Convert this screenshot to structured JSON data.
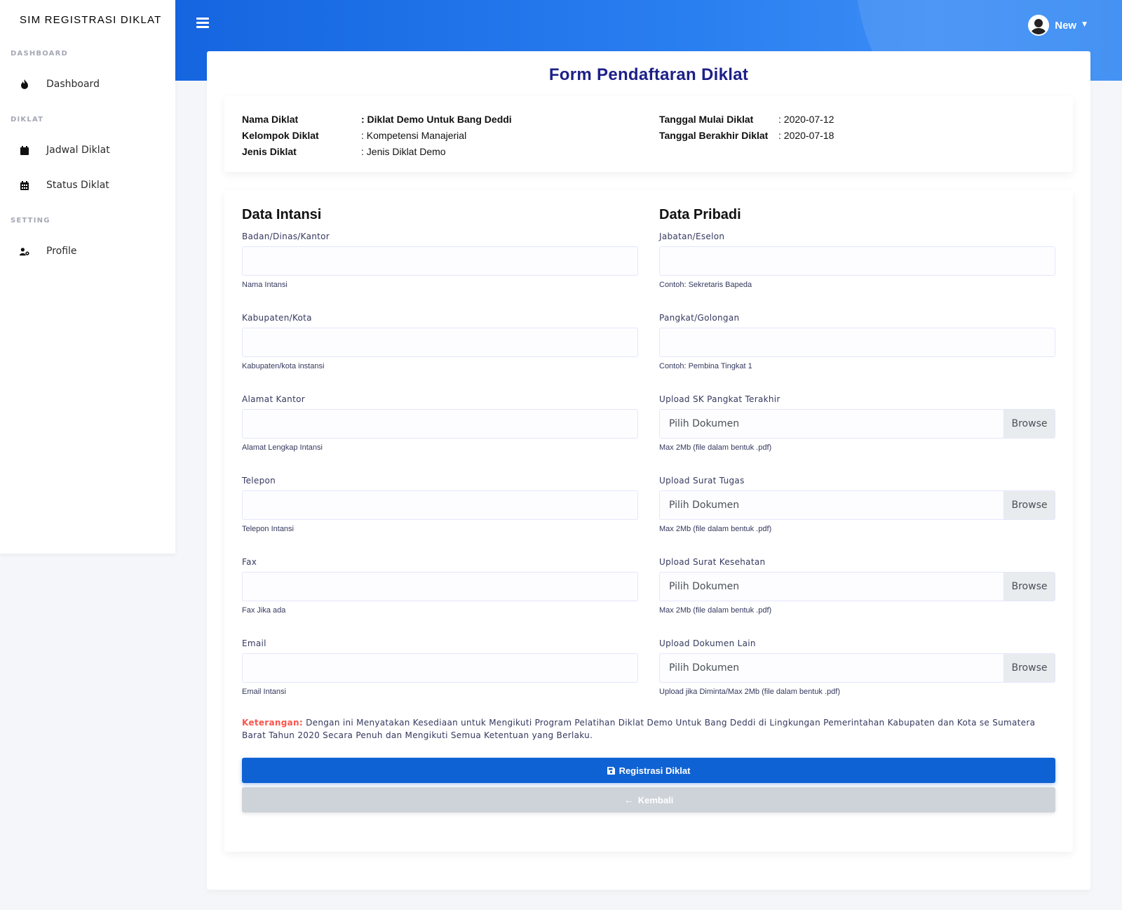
{
  "brand": "SIM REGISTRASI DIKLAT",
  "header": {
    "user_name": "New"
  },
  "sidebar": {
    "sections": [
      {
        "header": "DASHBOARD",
        "items": [
          {
            "label": "Dashboard",
            "icon": "fire-icon"
          }
        ]
      },
      {
        "header": "DIKLAT",
        "items": [
          {
            "label": "Jadwal Diklat",
            "icon": "calendar-icon"
          },
          {
            "label": "Status Diklat",
            "icon": "calendar-grid-icon"
          }
        ]
      },
      {
        "header": "SETTING",
        "items": [
          {
            "label": "Profile",
            "icon": "user-cog-icon"
          }
        ]
      }
    ]
  },
  "page": {
    "title": "Form Pendaftaran Diklat"
  },
  "info": {
    "nama_diklat": {
      "key": "Nama Diklat",
      "value": ": Diklat Demo Untuk Bang Deddi"
    },
    "kelompok_diklat": {
      "key": "Kelompok Diklat",
      "value": ": Kompetensi Manajerial"
    },
    "jenis_diklat": {
      "key": "Jenis Diklat",
      "value": ": Jenis Diklat Demo"
    },
    "tanggal_mulai": {
      "key": "Tanggal Mulai Diklat",
      "value": ": 2020-07-12"
    },
    "tanggal_berakhir": {
      "key": "Tanggal Berakhir Diklat",
      "value": ": 2020-07-18"
    }
  },
  "form": {
    "intansi": {
      "title": "Data Intansi",
      "fields": [
        {
          "label": "Badan/Dinas/Kantor",
          "help": "Nama Intansi",
          "value": ""
        },
        {
          "label": "Kabupaten/Kota",
          "help": "Kabupaten/kota instansi",
          "value": ""
        },
        {
          "label": "Alamat Kantor",
          "help": "Alamat Lengkap Intansi",
          "value": ""
        },
        {
          "label": "Telepon",
          "help": "Telepon Intansi",
          "value": ""
        },
        {
          "label": "Fax",
          "help": "Fax Jika ada",
          "value": ""
        },
        {
          "label": "Email",
          "help": "Email Intansi",
          "value": ""
        }
      ]
    },
    "pribadi": {
      "title": "Data Pribadi",
      "fields": [
        {
          "label": "Jabatan/Eselon",
          "help": "Contoh: Sekretaris Bapeda",
          "value": ""
        },
        {
          "label": "Pangkat/Golongan",
          "help": "Contoh: Pembina Tingkat 1",
          "value": ""
        }
      ],
      "uploads": [
        {
          "label": "Upload SK Pangkat Terakhir",
          "placeholder": "Pilih Dokumen",
          "browse": "Browse",
          "help": "Max 2Mb (file dalam bentuk .pdf)"
        },
        {
          "label": "Upload Surat Tugas",
          "placeholder": "Pilih Dokumen",
          "browse": "Browse",
          "help": "Max 2Mb (file dalam bentuk .pdf)"
        },
        {
          "label": "Upload Surat Kesehatan",
          "placeholder": "Pilih Dokumen",
          "browse": "Browse",
          "help": "Max 2Mb (file dalam bentuk .pdf)"
        },
        {
          "label": "Upload Dokumen Lain",
          "placeholder": "Pilih Dokumen",
          "browse": "Browse",
          "help": "Upload jika Diminta/Max 2Mb (file dalam bentuk .pdf)"
        }
      ]
    },
    "keterangan": {
      "label": "Keterangan:",
      "text": " Dengan ini Menyatakan Kesediaan untuk Mengikuti Program Pelatihan Diklat Demo Untuk Bang Deddi di Lingkungan Pemerintahan Kabupaten dan Kota se Sumatera Barat Tahun 2020 Secara Penuh dan Mengikuti Semua Ketentuan yang Berlaku."
    },
    "submit_label": "Registrasi Diklat",
    "back_label": "Kembali"
  },
  "colors": {
    "primary": "#0f62d3",
    "title": "#1d2088",
    "danger": "#fc544b",
    "secondary_button": "#cdd3d8"
  }
}
